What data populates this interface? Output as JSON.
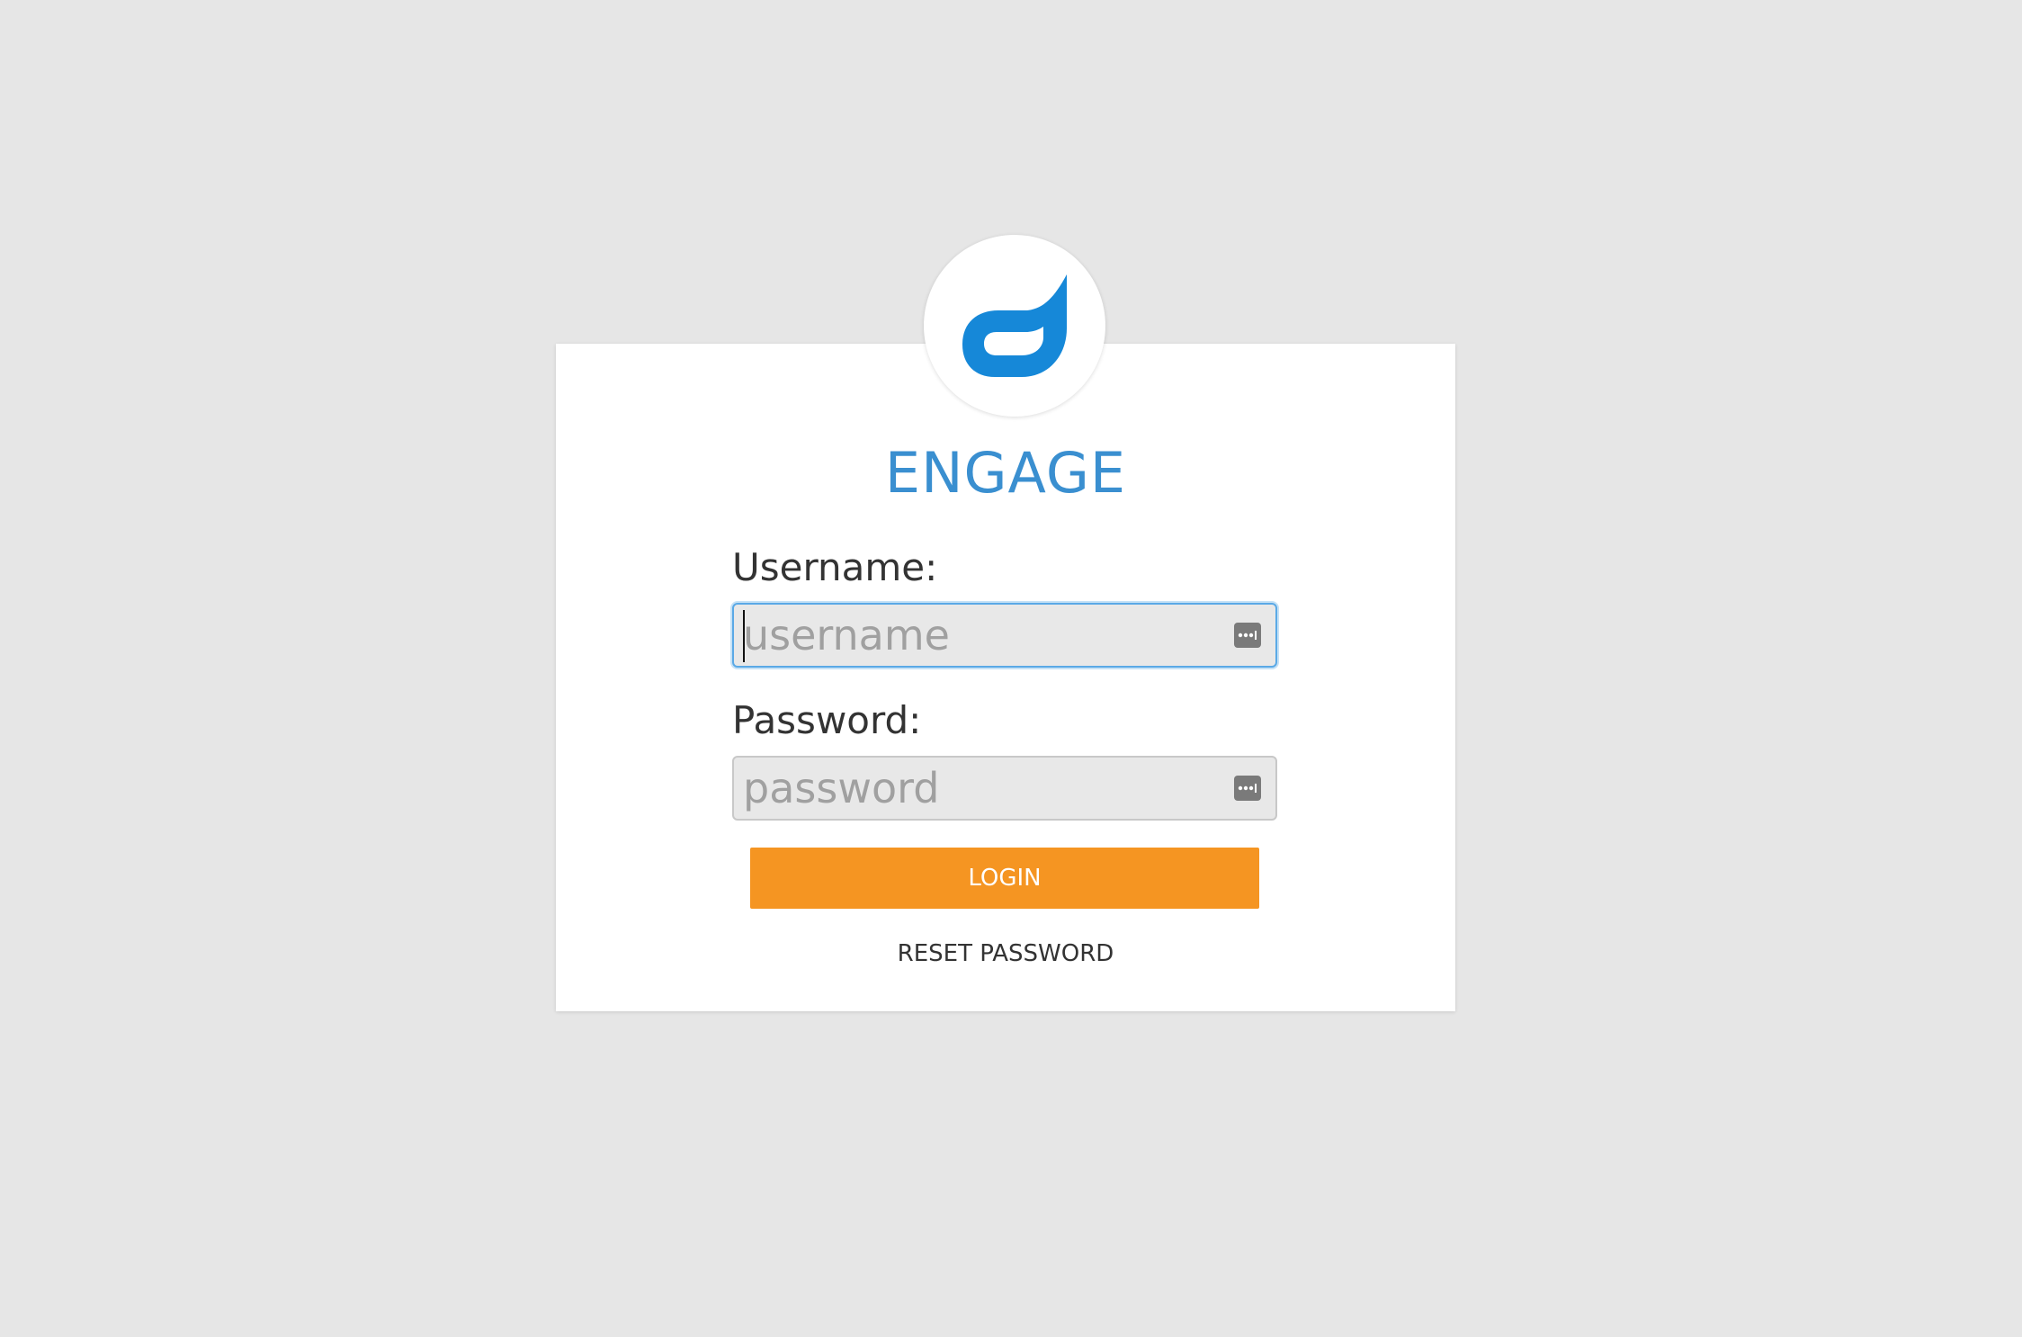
{
  "app": {
    "title": "ENGAGE",
    "logo_icon": "engage-logo-icon",
    "brand_color": "#3a8fd0"
  },
  "form": {
    "username": {
      "label": "Username:",
      "placeholder": "username",
      "value": "",
      "icon": "password-manager-key-icon"
    },
    "password": {
      "label": "Password:",
      "placeholder": "password",
      "value": "",
      "icon": "password-manager-key-icon"
    },
    "login_label": "LOGIN",
    "login_color": "#f59522",
    "reset_label": "RESET PASSWORD"
  }
}
